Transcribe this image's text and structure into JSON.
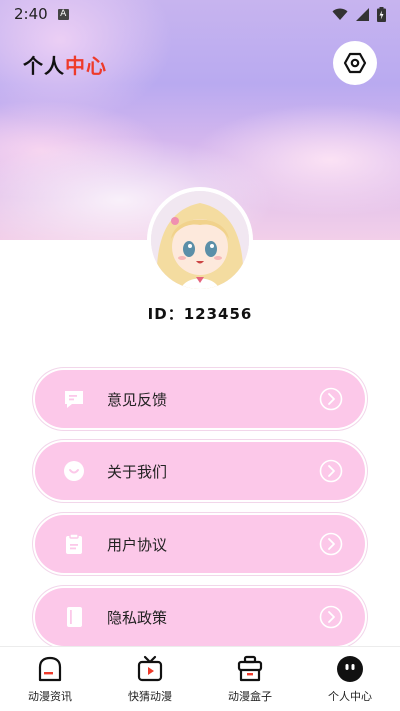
{
  "status_bar": {
    "time": "2:40",
    "notif_letter": "A"
  },
  "header": {
    "title_part1": "个人",
    "title_part2": "中心"
  },
  "profile": {
    "id_text": "ID：123456"
  },
  "menu": [
    {
      "label": "意见反馈",
      "icon": "chat-icon"
    },
    {
      "label": "关于我们",
      "icon": "smile-icon"
    },
    {
      "label": "用户协议",
      "icon": "clipboard-icon"
    },
    {
      "label": "隐私政策",
      "icon": "notebook-icon"
    }
  ],
  "tabs": [
    {
      "label": "动漫资讯",
      "icon": "news-icon",
      "active": false
    },
    {
      "label": "快猜动漫",
      "icon": "play-icon",
      "active": false
    },
    {
      "label": "动漫盒子",
      "icon": "box-icon",
      "active": false
    },
    {
      "label": "个人中心",
      "icon": "profile-icon",
      "active": true
    }
  ],
  "colors": {
    "accent": "#ee3a2a",
    "menu_bg": "#fcc8e9"
  }
}
